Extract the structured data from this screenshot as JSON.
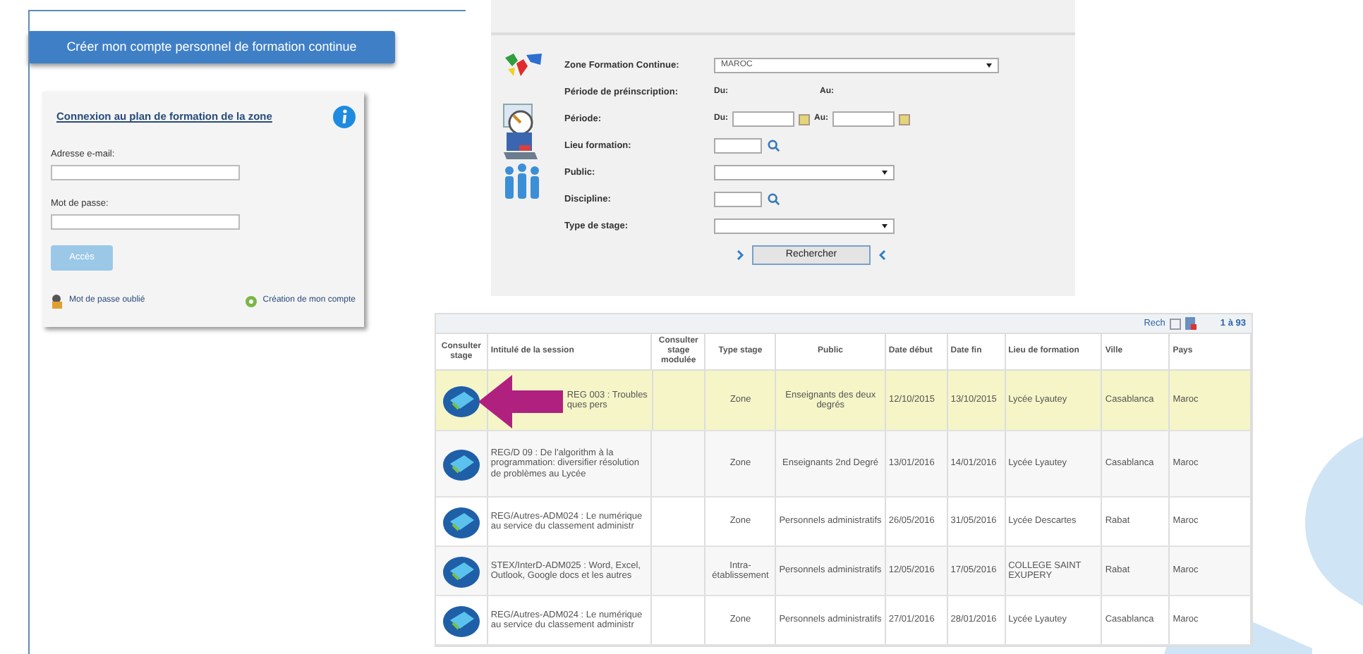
{
  "create_account_button": "Créer mon compte personnel de formation continue",
  "login": {
    "title": "Connexion au plan de formation de la zone",
    "email_label": "Adresse e-mail:",
    "password_label": "Mot de passe:",
    "submit": "Accès",
    "submit_disabled": true,
    "forgot_link": "Mot de passe oublié",
    "create_link": "Création de mon compte"
  },
  "search_form": {
    "fields": [
      {
        "kind": "select",
        "label": "Zone Formation Continue:",
        "value": "MAROC"
      },
      {
        "kind": "range_text",
        "label": "Période de préinscription:",
        "from": "Du:",
        "to": "Au:"
      },
      {
        "kind": "date_range",
        "label": "Période:",
        "from": "Du:",
        "to": "Au:"
      },
      {
        "kind": "lookup",
        "label": "Lieu formation:"
      },
      {
        "kind": "select",
        "label": "Public:"
      },
      {
        "kind": "lookup",
        "label": "Discipline:"
      },
      {
        "kind": "select",
        "label": "Type de stage:"
      }
    ],
    "submit": "Rechercher"
  },
  "table": {
    "toolbar_link": "Rech",
    "count": "1 à 93",
    "columns": [
      "Consulter stage",
      "Intitulé de la session",
      "Consulter stage modulée",
      "Type stage",
      "Public",
      "Date début",
      "Date fin",
      "Lieu de formation",
      "Ville",
      "Pays"
    ],
    "rows": [
      {
        "selected": true,
        "title": "REG 003 : Troubles ques pers",
        "type": "Zone",
        "public": "Enseignants des deux degrés",
        "start": "12/10/2015",
        "end": "13/10/2015",
        "place": "Lycée Lyautey",
        "city": "Casablanca",
        "country": "Maroc"
      },
      {
        "selected": false,
        "title": "REG/D 09 : De l'algorithm à la programmation: diversifier résolution de problèmes au Lycée",
        "type": "Zone",
        "public": "Enseignants 2nd Degré",
        "start": "13/01/2016",
        "end": "14/01/2016",
        "place": "Lycée Lyautey",
        "city": "Casablanca",
        "country": "Maroc"
      },
      {
        "selected": false,
        "title": "REG/Autres-ADM024 : Le numérique au service du classement administr",
        "type": "Zone",
        "public": "Personnels administratifs",
        "start": "26/05/2016",
        "end": "31/05/2016",
        "place": "Lycée Descartes",
        "city": "Rabat",
        "country": "Maroc"
      },
      {
        "selected": false,
        "title": "STEX/InterD-ADM025 : Word, Excel, Outlook, Google docs et les autres",
        "type": "Intra-établissement",
        "public": "Personnels administratifs",
        "start": "12/05/2016",
        "end": "17/05/2016",
        "place": "COLLEGE SAINT EXUPERY",
        "city": "Rabat",
        "country": "Maroc"
      },
      {
        "selected": false,
        "title": "REG/Autres-ADM024 : Le numérique au service du classement administr",
        "type": "Zone",
        "public": "Personnels administratifs",
        "start": "27/01/2016",
        "end": "28/01/2016",
        "place": "Lycée Lyautey",
        "city": "Casablanca",
        "country": "Maroc"
      }
    ]
  }
}
